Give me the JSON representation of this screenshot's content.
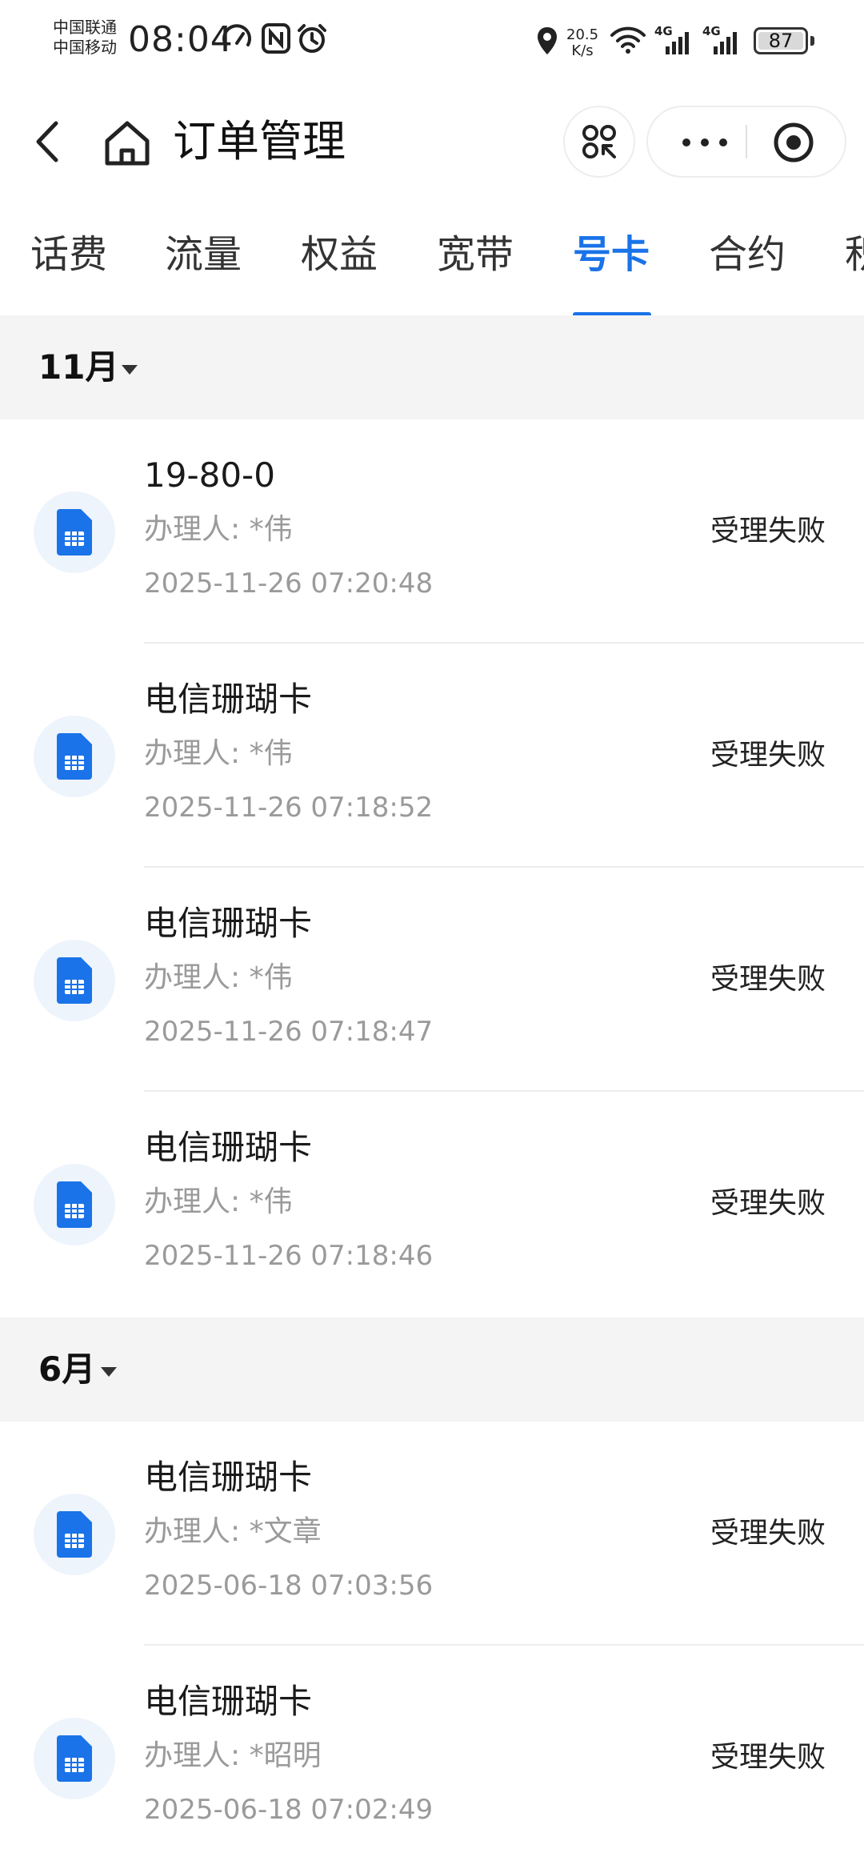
{
  "status_bar": {
    "carrier1": "中国联通",
    "carrier2": "中国移动",
    "time": "08:04",
    "speed_value": "20.5",
    "speed_unit": "K/s",
    "net1": "4G",
    "net2": "4G",
    "battery": "87",
    "icons": [
      "speedometer-icon",
      "nfc-icon",
      "alarm-icon",
      "location-icon",
      "wifi-icon",
      "signal-icon",
      "battery-icon"
    ]
  },
  "nav": {
    "title": "订单管理",
    "icons": [
      "back-icon",
      "home-icon",
      "scan-icon",
      "more-icon",
      "target-icon"
    ]
  },
  "tabs": [
    {
      "label": "话费",
      "active": false
    },
    {
      "label": "流量",
      "active": false
    },
    {
      "label": "权益",
      "active": false
    },
    {
      "label": "宽带",
      "active": false
    },
    {
      "label": "号卡",
      "active": true
    },
    {
      "label": "合约",
      "active": false
    },
    {
      "label": "积",
      "active": false
    }
  ],
  "accent_color": "#1a73e8",
  "months": [
    {
      "label": "11月",
      "orders": [
        {
          "name": "19-80-0",
          "handler": "办理人: *伟",
          "time": "2025-11-26 07:20:48",
          "status": "受理失败"
        },
        {
          "name": "电信珊瑚卡",
          "handler": "办理人: *伟",
          "time": "2025-11-26 07:18:52",
          "status": "受理失败"
        },
        {
          "name": "电信珊瑚卡",
          "handler": "办理人: *伟",
          "time": "2025-11-26 07:18:47",
          "status": "受理失败"
        },
        {
          "name": "电信珊瑚卡",
          "handler": "办理人: *伟",
          "time": "2025-11-26 07:18:46",
          "status": "受理失败"
        }
      ]
    },
    {
      "label": "6月",
      "orders": [
        {
          "name": "电信珊瑚卡",
          "handler": "办理人: *文章",
          "time": "2025-06-18 07:03:56",
          "status": "受理失败"
        },
        {
          "name": "电信珊瑚卡",
          "handler": "办理人: *昭明",
          "time": "2025-06-18 07:02:49",
          "status": "受理失败"
        }
      ]
    }
  ]
}
